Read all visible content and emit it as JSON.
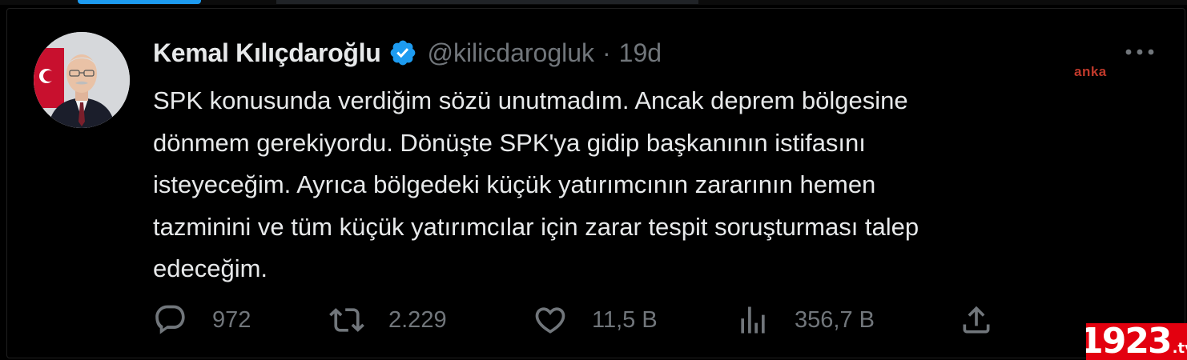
{
  "tweet": {
    "author": {
      "display_name": "Kemal Kılıçdaroğlu",
      "handle": "@kilicdarogluk",
      "separator": "·",
      "time": "19d",
      "verified": true
    },
    "text_lines": [
      "SPK konusunda verdiğim sözü unutmadım. Ancak deprem bölgesine",
      "dönmem gerekiyordu. Dönüşte SPK'ya gidip başkanının istifasını",
      "isteyeceğim. Ayrıca bölgedeki küçük yatırımcının zararının hemen",
      "tazminini ve tüm küçük yatırımcılar için zarar tespit soruşturması talep",
      "edeceğim."
    ],
    "actions": {
      "reply": {
        "icon": "reply-icon",
        "count": "972"
      },
      "retweet": {
        "icon": "retweet-icon",
        "count": "2.229"
      },
      "like": {
        "icon": "heart-icon",
        "count": "11,5 B"
      },
      "views": {
        "icon": "views-chart-icon",
        "count": "356,7 B"
      },
      "share": {
        "icon": "share-icon"
      }
    },
    "more_icon": "more-options-icon"
  },
  "watermarks": {
    "anka": "anka",
    "site_number": "1923",
    "site_suffix": ".tv"
  },
  "colors": {
    "background": "#000000",
    "text_primary": "#e7e9ea",
    "text_secondary": "#71767b",
    "verified_blue": "#1d9bf0",
    "anka_red": "#c0392b",
    "logo_red": "#e3000f"
  }
}
